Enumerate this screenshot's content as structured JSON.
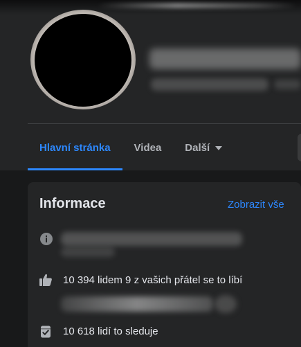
{
  "tabs": [
    {
      "label": "Hlavní stránka",
      "active": true
    },
    {
      "label": "Videa",
      "active": false
    },
    {
      "label": "Další",
      "active": false
    }
  ],
  "info": {
    "title": "Informace",
    "see_all": "Zobrazit vše",
    "rows": [
      {
        "icon": "info-icon",
        "text": ""
      },
      {
        "icon": "thumbs-up-icon",
        "text": "10 394 lidem 9 z vašich přátel se to líbí"
      },
      {
        "icon": "follow-check-icon",
        "text": "10 618 lidí to sleduje"
      }
    ]
  },
  "colors": {
    "accent": "#2d88ff",
    "background": "#18191a",
    "surface": "#242526",
    "text": "#e4e6eb",
    "muted": "#b0b3b8"
  }
}
